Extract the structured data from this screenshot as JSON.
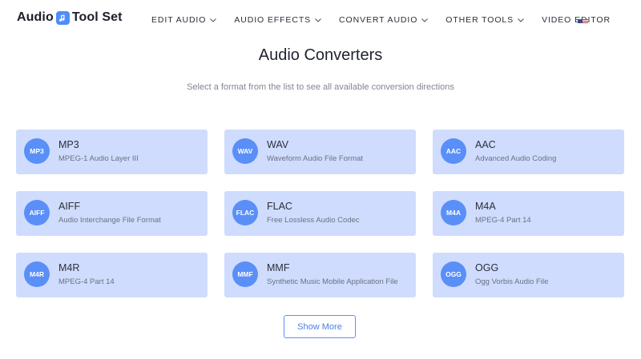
{
  "header": {
    "logo_left": "Audio",
    "logo_right": "Tool Set",
    "nav": [
      {
        "label": "EDIT AUDIO",
        "has_dropdown": true
      },
      {
        "label": "AUDIO EFFECTS",
        "has_dropdown": true
      },
      {
        "label": "CONVERT AUDIO",
        "has_dropdown": true
      },
      {
        "label": "OTHER TOOLS",
        "has_dropdown": true
      },
      {
        "label": "VIDEO EDITOR",
        "has_dropdown": false
      }
    ],
    "language_flag": "us-flag-icon"
  },
  "main": {
    "title": "Audio Converters",
    "subtitle": "Select a format from the list to see all available conversion directions",
    "formats": [
      {
        "badge": "MP3",
        "name": "MP3",
        "desc": "MPEG-1 Audio Layer III"
      },
      {
        "badge": "WAV",
        "name": "WAV",
        "desc": "Waveform Audio File Format"
      },
      {
        "badge": "AAC",
        "name": "AAC",
        "desc": "Advanced Audio Coding"
      },
      {
        "badge": "AIFF",
        "name": "AIFF",
        "desc": "Audio Interchange File Format"
      },
      {
        "badge": "FLAC",
        "name": "FLAC",
        "desc": "Free Lossless Audio Codec"
      },
      {
        "badge": "M4A",
        "name": "M4A",
        "desc": "MPEG-4 Part 14"
      },
      {
        "badge": "M4R",
        "name": "M4R",
        "desc": "MPEG-4 Part 14"
      },
      {
        "badge": "MMF",
        "name": "MMF",
        "desc": "Synthetic Music Mobile Application File"
      },
      {
        "badge": "OGG",
        "name": "OGG",
        "desc": "Ogg Vorbis Audio File"
      }
    ],
    "show_more_label": "Show More"
  },
  "colors": {
    "accent": "#5a8ff8",
    "card_bg": "#cfdcfd",
    "logo_badge": "#4f8df9"
  }
}
